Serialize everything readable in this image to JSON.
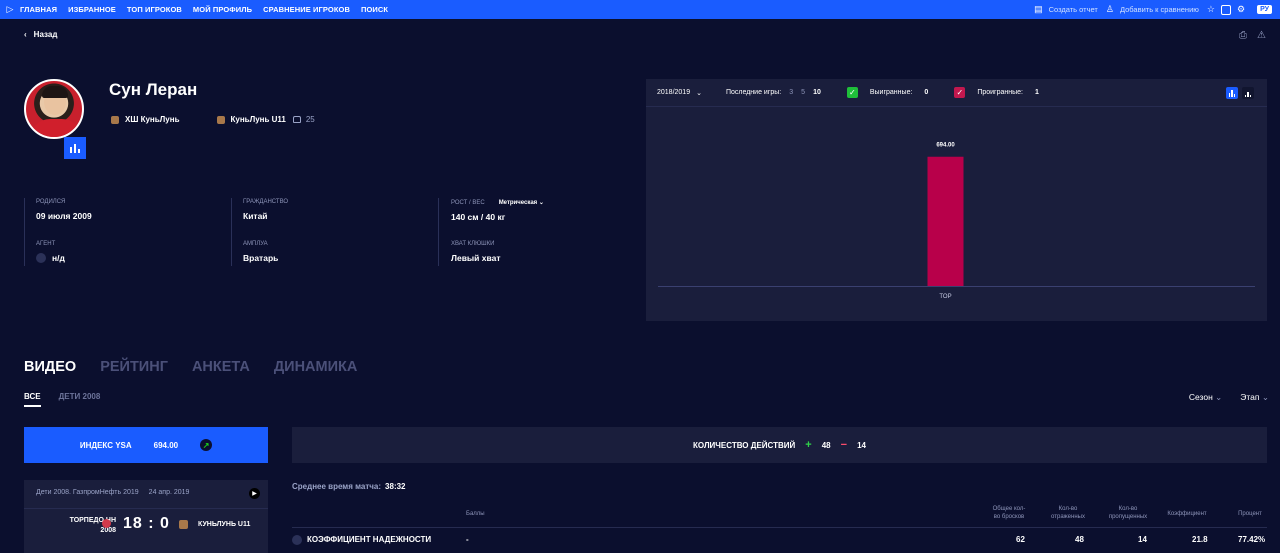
{
  "nav": {
    "items": [
      "ГЛАВНАЯ",
      "ИЗБРАННОЕ",
      "ТОП ИГРОКОВ",
      "МОЙ ПРОФИЛЬ",
      "СРАВНЕНИЕ ИГРОКОВ",
      "ПОИСК"
    ],
    "create_report": "Создать отчет",
    "add_compare": "Добавить к сравнению",
    "lang": "РУ"
  },
  "back_label": "Назад",
  "player": {
    "name": "Сун Леран",
    "team1": "ХШ КуньЛунь",
    "team2": "КуньЛунь U11",
    "number": "25"
  },
  "info": {
    "born_label": "РОДИЛСЯ",
    "born": "09 июля 2009",
    "citizen_label": "ГРАЖДАНСТВО",
    "citizen": "Китай",
    "hw_label": "РОСТ / ВЕС",
    "hw_unit": "Метрическая",
    "hw": "140 см / 40 кг",
    "agent_label": "АГЕНТ",
    "agent": "н/д",
    "role_label": "АМПЛУА",
    "role": "Вратарь",
    "grip_label": "ХВАТ КЛЮШКИ",
    "grip": "Левый хват"
  },
  "panel": {
    "season": "2018/2019",
    "last_games_label": "Последние игры:",
    "last_games_opts": [
      "3",
      "5",
      "10"
    ],
    "won_label": "Выигранные:",
    "won": "0",
    "lost_label": "Проигранные:",
    "lost": "1"
  },
  "chart_data": {
    "type": "bar",
    "categories": [
      "TOP"
    ],
    "values": [
      694.0
    ],
    "value_labels": [
      "694.00"
    ],
    "ylim": [
      0,
      800
    ],
    "bar_color": "#b8004a"
  },
  "tabs": [
    "ВИДЕО",
    "РЕЙТИНГ",
    "АНКЕТА",
    "ДИНАМИКА"
  ],
  "subtabs": [
    "ВСЕ",
    "ДЕТИ 2008"
  ],
  "filters": [
    "Сезон",
    "Этап"
  ],
  "index": {
    "label": "ИНДЕКС YSA",
    "value": "694.00"
  },
  "actions": {
    "label": "КОЛИЧЕСТВО ДЕЙСТВИЙ",
    "plus": "48",
    "minus": "14"
  },
  "match": {
    "tournament": "Дети 2008. ГазпромНефть 2019",
    "date": "24 апр. 2019",
    "home": "ТОРПЕДО НН 2008",
    "home_l1": "ТОРПЕДО НН",
    "home_l2": "2008",
    "score": "18 : 0",
    "away": "КУНЬЛУНЬ U11"
  },
  "avg_time": {
    "label": "Среднее время матча:",
    "value": "38:32"
  },
  "table": {
    "points_head": "Баллы",
    "col1_a": "Общее кол-",
    "col1_b": "во бросков",
    "col2_a": "Кол-во",
    "col2_b": "отраженных",
    "col3_a": "Кол-во",
    "col3_b": "пропущенных",
    "col4": "Коэффициент",
    "col5": "Процент",
    "row_label": "КОЭФФИЦИЕНТ НАДЕЖНОСТИ",
    "row_points": "-",
    "row_v1": "62",
    "row_v2": "48",
    "row_v3": "14",
    "row_v4": "21.8",
    "row_v5": "77.42%"
  }
}
